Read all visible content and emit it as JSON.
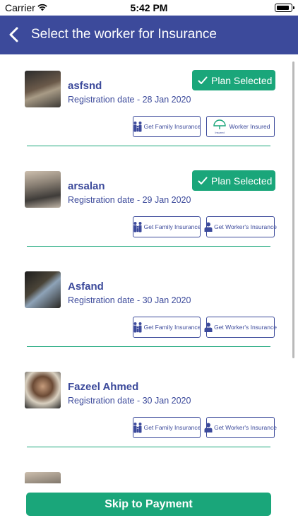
{
  "status_bar": {
    "carrier": "Carrier",
    "time": "5:42 PM"
  },
  "header": {
    "title": "Select the worker for Insurance"
  },
  "colors": {
    "primary": "#3c4a9b",
    "accent": "#1aa67a"
  },
  "workers": [
    {
      "name": "asfsnd",
      "registration": "Registration date - 28 Jan 2020",
      "plan_selected": true,
      "plan_label": "Plan Selected",
      "family_label": "Get Family Insurance",
      "worker_label": "Worker Insured",
      "worker_insured": true,
      "worker_insured_caption": "Insured"
    },
    {
      "name": "arsalan",
      "registration": "Registration date - 29 Jan 2020",
      "plan_selected": true,
      "plan_label": "Plan Selected",
      "family_label": "Get Family Insurance",
      "worker_label": "Get Worker's Insurance",
      "worker_insured": false
    },
    {
      "name": "Asfand",
      "registration": "Registration date - 30 Jan 2020",
      "plan_selected": false,
      "family_label": "Get Family Insurance",
      "worker_label": "Get Worker's Insurance",
      "worker_insured": false
    },
    {
      "name": "Fazeel Ahmed",
      "registration": "Registration date - 30 Jan 2020",
      "plan_selected": false,
      "family_label": "Get Family Insurance",
      "worker_label": "Get Worker's Insurance",
      "worker_insured": false
    }
  ],
  "footer": {
    "skip_label": "Skip to Payment"
  }
}
